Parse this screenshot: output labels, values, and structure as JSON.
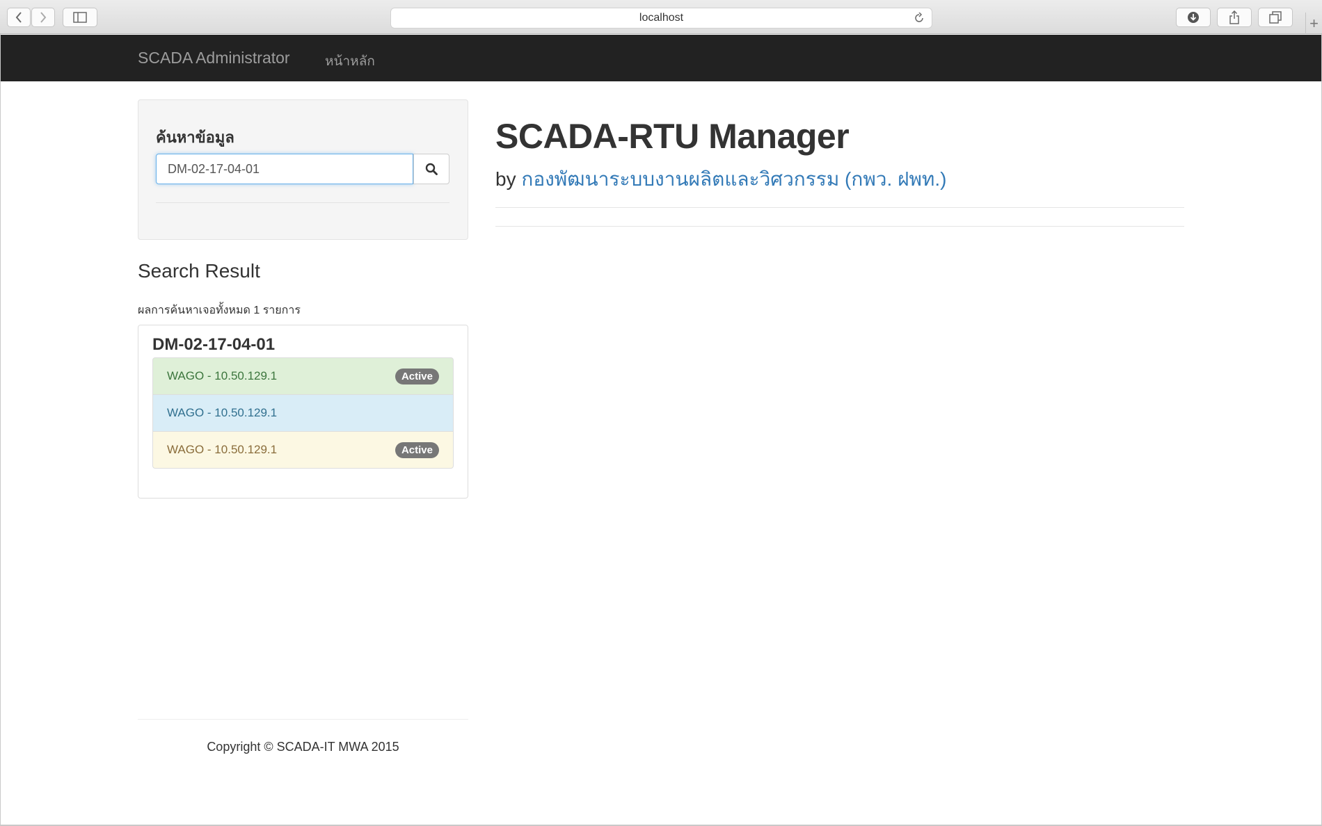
{
  "browser": {
    "url": "localhost",
    "icons": [
      "back-icon",
      "forward-icon",
      "sidebar-icon",
      "reload-icon",
      "download-icon",
      "share-icon",
      "tabs-icon",
      "plus-icon"
    ]
  },
  "navbar": {
    "brand": "SCADA Administrator",
    "links": [
      "หน้าหลัก"
    ]
  },
  "search": {
    "title": "ค้นหาข้อมูล",
    "value": "DM-02-17-04-01"
  },
  "results": {
    "section_title": "Search Result",
    "count_text": "ผลการค้นหาเจอทั้งหมด 1 รายการ",
    "panel_title": "DM-02-17-04-01",
    "items": [
      {
        "label": "WAGO - 10.50.129.1",
        "badge": "Active",
        "style": "success"
      },
      {
        "label": "WAGO - 10.50.129.1",
        "badge": "",
        "style": "info"
      },
      {
        "label": "WAGO - 10.50.129.1",
        "badge": "Active",
        "style": "warning"
      }
    ]
  },
  "main": {
    "title": "SCADA-RTU Manager",
    "by": "by",
    "org": "กองพัฒนาระบบงานผลิตและวิศวกรรม (กพว. ฝพท.)"
  },
  "footer": {
    "copyright": "Copyright © SCADA-IT MWA 2015"
  },
  "colors": {
    "navbar_bg": "#222222",
    "link": "#337ab7",
    "success_bg": "#dff0d8",
    "info_bg": "#d9edf7",
    "warning_bg": "#fcf8e3",
    "badge_bg": "#777777"
  }
}
